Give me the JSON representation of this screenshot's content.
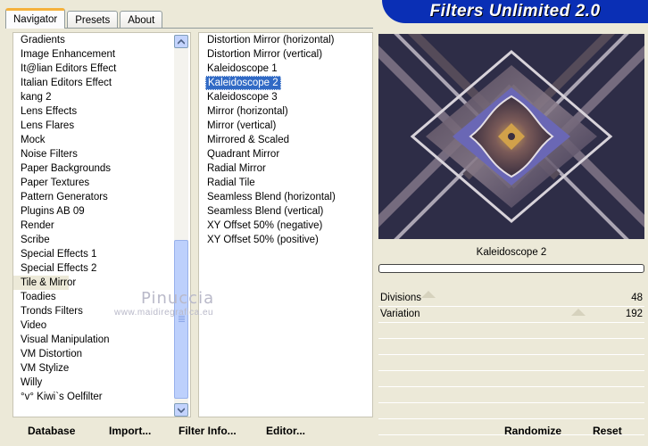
{
  "tabs": [
    {
      "label": "Navigator",
      "active": true
    },
    {
      "label": "Presets",
      "active": false
    },
    {
      "label": "About",
      "active": false
    }
  ],
  "banner": {
    "title": "Filters Unlimited 2.0"
  },
  "categories": {
    "items": [
      "Gradients",
      "Image Enhancement",
      "It@lian Editors Effect",
      "Italian Editors Effect",
      "kang 2",
      "Lens Effects",
      "Lens Flares",
      "Mock",
      "Noise Filters",
      "Paper Backgrounds",
      "Paper Textures",
      "Pattern Generators",
      "Plugins AB 09",
      "Render",
      "Scribe",
      "Special Effects 1",
      "Special Effects 2",
      "Tile & Mirror",
      "Toadies",
      "Tronds Filters",
      "Video",
      "Visual Manipulation",
      "VM Distortion",
      "VM Stylize",
      "Willy",
      "°v° Kiwi`s Oelfilter"
    ],
    "selected": "Tile & Mirror"
  },
  "filters": {
    "items": [
      "Distortion Mirror (horizontal)",
      "Distortion Mirror (vertical)",
      "Kaleidoscope 1",
      "Kaleidoscope 2",
      "Kaleidoscope 3",
      "Mirror (horizontal)",
      "Mirror (vertical)",
      "Mirrored & Scaled",
      "Quadrant Mirror",
      "Radial Mirror",
      "Radial Tile",
      "Seamless Blend (horizontal)",
      "Seamless Blend (vertical)",
      "XY Offset 50% (negative)",
      "XY Offset 50% (positive)"
    ],
    "selected": "Kaleidoscope 2"
  },
  "preview": {
    "filter_name": "Kaleidoscope 2"
  },
  "params": [
    {
      "label": "Divisions",
      "value": "48",
      "level": 0.19
    },
    {
      "label": "Variation",
      "value": "192",
      "level": 0.75
    }
  ],
  "buttons": {
    "database": "Database",
    "import": "Import...",
    "filter_info": "Filter Info...",
    "editor": "Editor...",
    "randomize": "Randomize",
    "reset": "Reset"
  },
  "watermark": {
    "line1": "Pinuccia",
    "line2": "www.maidiregrafica.eu"
  },
  "colors": {
    "accent": "#316ac5",
    "banner": "#0a2fb5",
    "tab_highlight": "#f5b13b"
  }
}
